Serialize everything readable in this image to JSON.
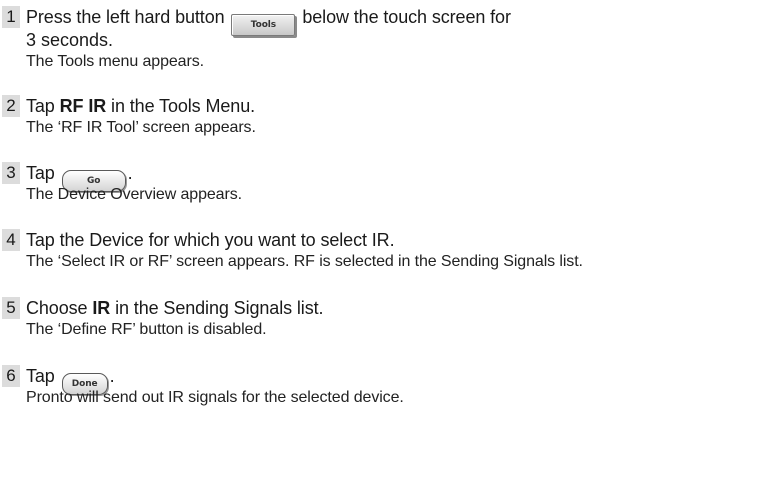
{
  "steps": [
    {
      "number": "1",
      "instruction_before": "Press the left hard button",
      "button_label": "Tools",
      "instruction_after": "below the touch screen for",
      "instruction_line2": "3 seconds.",
      "description": "The Tools menu appears."
    },
    {
      "number": "2",
      "instruction_before": "Tap",
      "instruction_bold": "RF IR",
      "instruction_after": "in the Tools Menu.",
      "description": "The ‘RF IR Tool’ screen appears."
    },
    {
      "number": "3",
      "instruction_before": "Tap",
      "button_label": "Go",
      "instruction_after": ".",
      "description": "The Device Overview appears."
    },
    {
      "number": "4",
      "instruction": "Tap the Device for which you want to select IR.",
      "description": "The ‘Select IR or RF’ screen appears. RF is selected in the Sending Signals list."
    },
    {
      "number": "5",
      "instruction_before": "Choose",
      "instruction_bold": "IR",
      "instruction_after": "in the Sending Signals list.",
      "description": "The ‘Define RF’ button is disabled."
    },
    {
      "number": "6",
      "instruction_before": "Tap",
      "button_label": "Done",
      "instruction_after": ".",
      "description": "Pronto will send out IR signals for the selected device."
    }
  ]
}
